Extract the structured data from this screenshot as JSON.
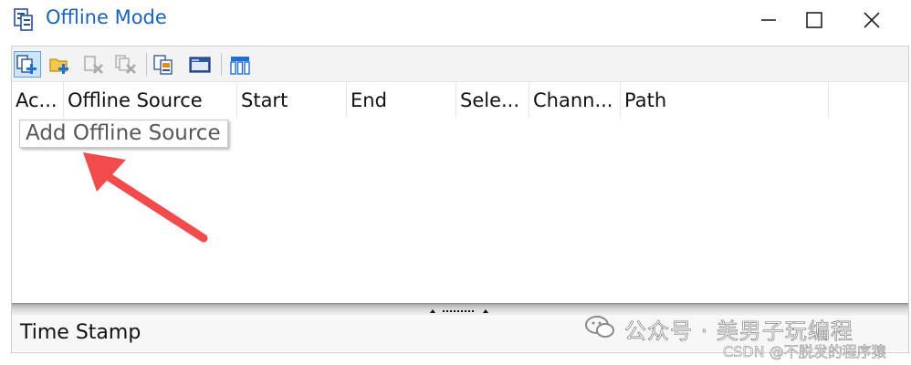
{
  "window": {
    "title": "Offline Mode",
    "accent_color": "#1a63b8",
    "controls": [
      "minimize-icon",
      "maximize-icon",
      "close-icon"
    ]
  },
  "toolbar": {
    "buttons": [
      {
        "icon": "add-offline-source-icon",
        "state": "active"
      },
      {
        "icon": "add-folder-icon",
        "state": "enabled"
      },
      {
        "icon": "remove-source-icon",
        "state": "disabled"
      },
      {
        "icon": "remove-all-sources-icon",
        "state": "disabled"
      },
      {
        "icon": "copy-source-icon",
        "state": "enabled"
      },
      {
        "icon": "open-folder-icon",
        "state": "enabled"
      },
      {
        "icon": "column-settings-icon",
        "state": "enabled"
      }
    ]
  },
  "columns": [
    "Ac...",
    "Offline Source",
    "Start",
    "End",
    "Sele...",
    "Chann...",
    "Path"
  ],
  "rows": [],
  "tooltip": {
    "text": "Add Offline Source"
  },
  "annotation": {
    "arrow_color": "#f24b4b"
  },
  "statusbar": {
    "label": "Time Stamp"
  },
  "watermark": {
    "main": "公众号 · 美男子玩编程",
    "sub": "CSDN @不脱发的程序猿"
  }
}
